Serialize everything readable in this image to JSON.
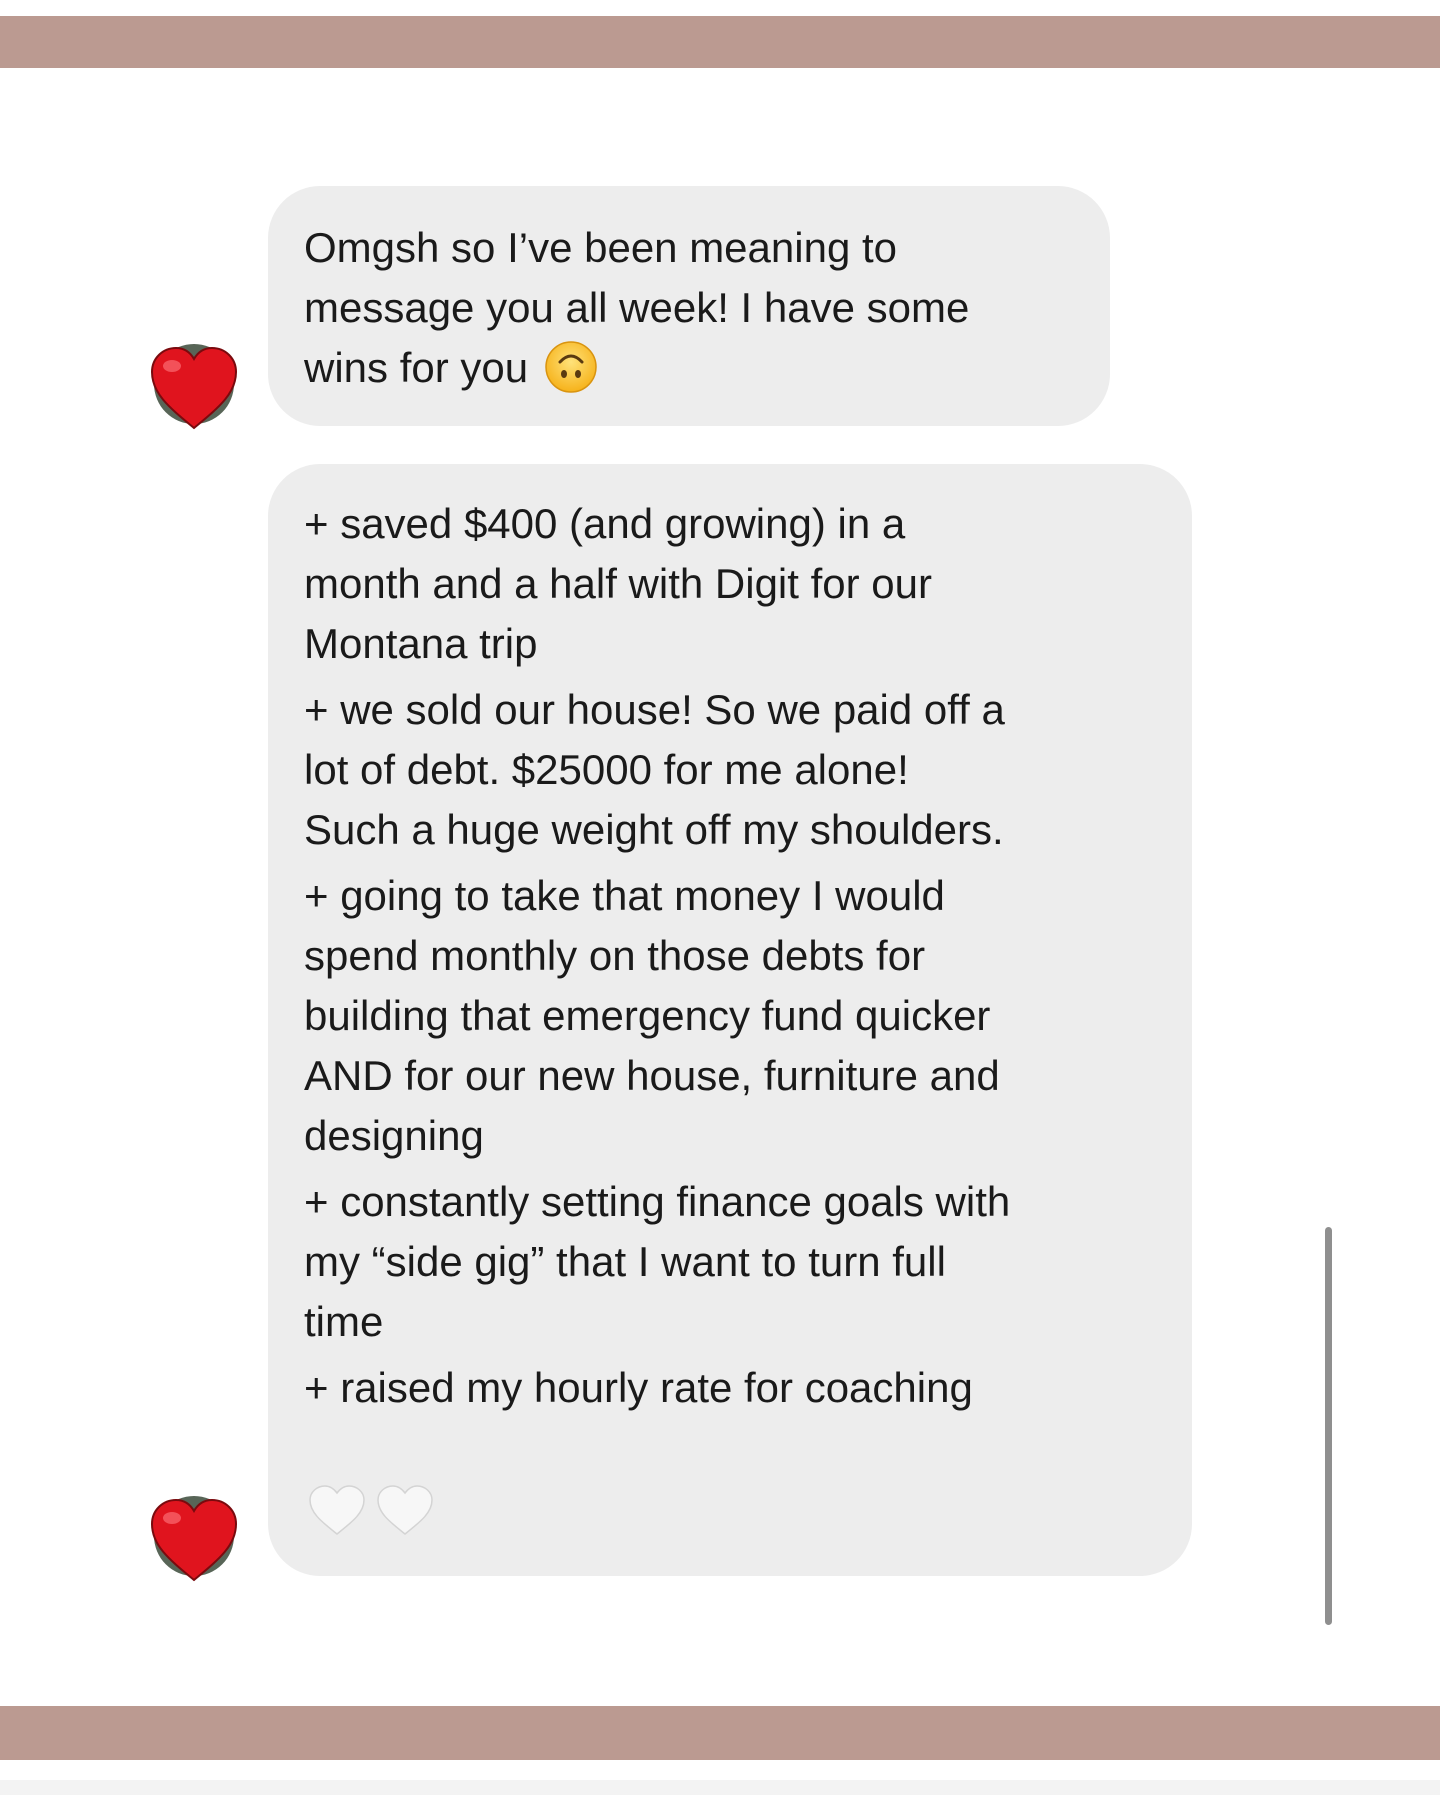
{
  "conversation": {
    "messages": [
      {
        "lines": [
          "Omgsh so I’ve been meaning to",
          "message you all week! I have some",
          "wins for you"
        ],
        "trailing_emoji": "upside-down-face-emoji"
      },
      {
        "items": [
          [
            "+ saved $400 (and growing) in a",
            "month and a half with Digit for our",
            "Montana trip"
          ],
          [
            "+ we sold our house! So we paid off a",
            "lot of debt. $25000 for me alone!",
            "Such a huge weight off my shoulders."
          ],
          [
            "+ going to take that money I would",
            "spend monthly on those debts for",
            "building that emergency fund quicker",
            "AND for our new house, furniture and",
            "designing"
          ],
          [
            "+ constantly setting finance goals with",
            "my “side gig” that I want to turn full",
            "time"
          ],
          [
            "+ raised my hourly rate for coaching"
          ]
        ],
        "reactions": [
          "white-heart-icon",
          "white-heart-icon"
        ]
      }
    ],
    "avatar_icon": "red-heart-icon"
  },
  "colors": {
    "band": "#bb9a91",
    "bubble": "#ededed",
    "text": "#1a1a1a",
    "heart": "#e0141e"
  }
}
